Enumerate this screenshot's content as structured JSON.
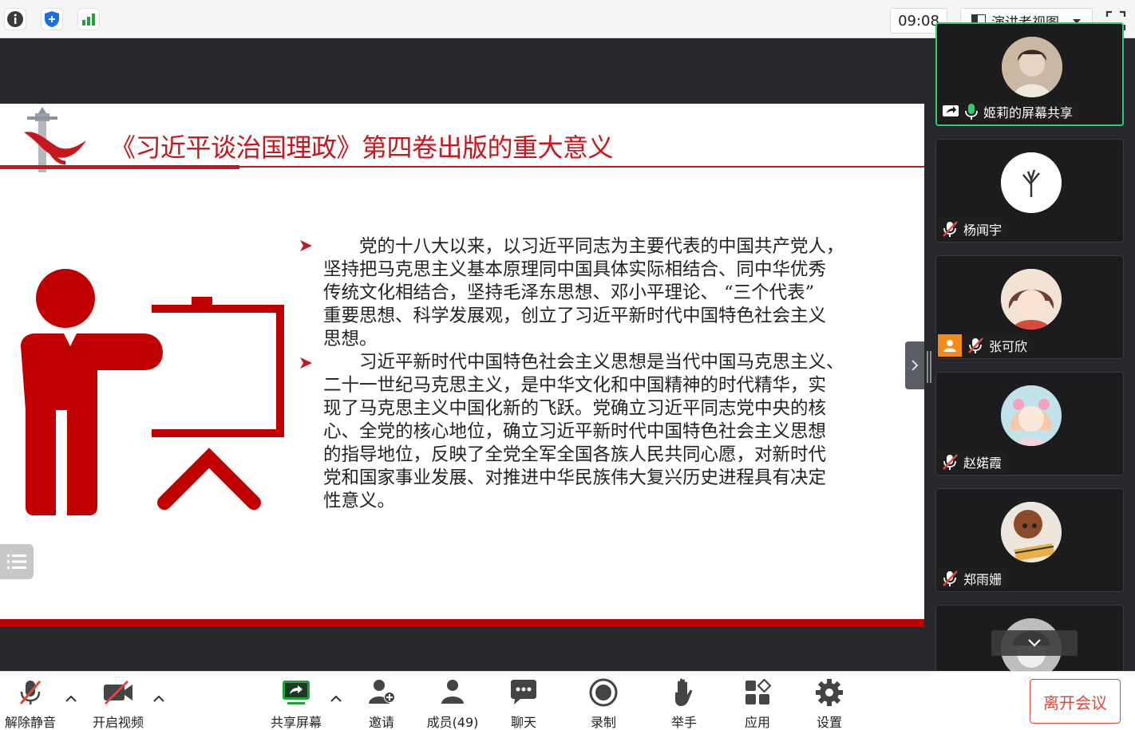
{
  "topbar": {
    "timer": "09:08",
    "view_mode_label": "演讲者视图"
  },
  "slide": {
    "title": "《习近平谈治国理政》第四卷出版的重大意义",
    "paragraph1": [
      "　　党的十八大以来，以习近平同志为主要代表的中国共产党人，",
      "坚持把马克思主义基本原理同中国具体实际相结合、同中华优秀",
      "传统文化相结合，坚持毛泽东思想、邓小平理论、 “三个代表”",
      "重要思想、科学发展观，创立了习近平新时代中国特色社会主义",
      "思想。"
    ],
    "paragraph2": [
      "　　习近平新时代中国特色社会主义思想是当代中国马克思主义、",
      "二十一世纪马克思主义，是中华文化和中国精神的时代精华，实",
      "现了马克思主义中国化新的飞跃。党确立习近平同志党中央的核",
      "心、全党的核心地位，确立习近平新时代中国特色社会主义思想",
      "的指导地位，反映了全党全军全国各族人民共同心愿，对新时代",
      "党和国家事业发展、对推进中华民族伟大复兴历史进程具有决定",
      "性意义。"
    ]
  },
  "participants": [
    {
      "name": "姬莉的屏幕共享",
      "status": "sharing",
      "mic": "on"
    },
    {
      "name": "杨闻宇",
      "mic": "muted"
    },
    {
      "name": "张可欣",
      "mic": "muted"
    },
    {
      "name": "赵婼霞",
      "mic": "muted"
    },
    {
      "name": "郑雨姗",
      "mic": "muted"
    }
  ],
  "toolbar": {
    "unmute": "解除静音",
    "start_video": "开启视频",
    "share_screen": "共享屏幕",
    "invite": "邀请",
    "members": "成员(49)",
    "chat": "聊天",
    "record": "录制",
    "raise_hand": "举手",
    "apps": "应用",
    "settings": "设置",
    "leave": "离开会议"
  },
  "colors": {
    "slide_red": "#c8161d",
    "active_speaker": "#2ecc71",
    "leave_red": "#e0473c",
    "share_green": "#21a33a"
  }
}
